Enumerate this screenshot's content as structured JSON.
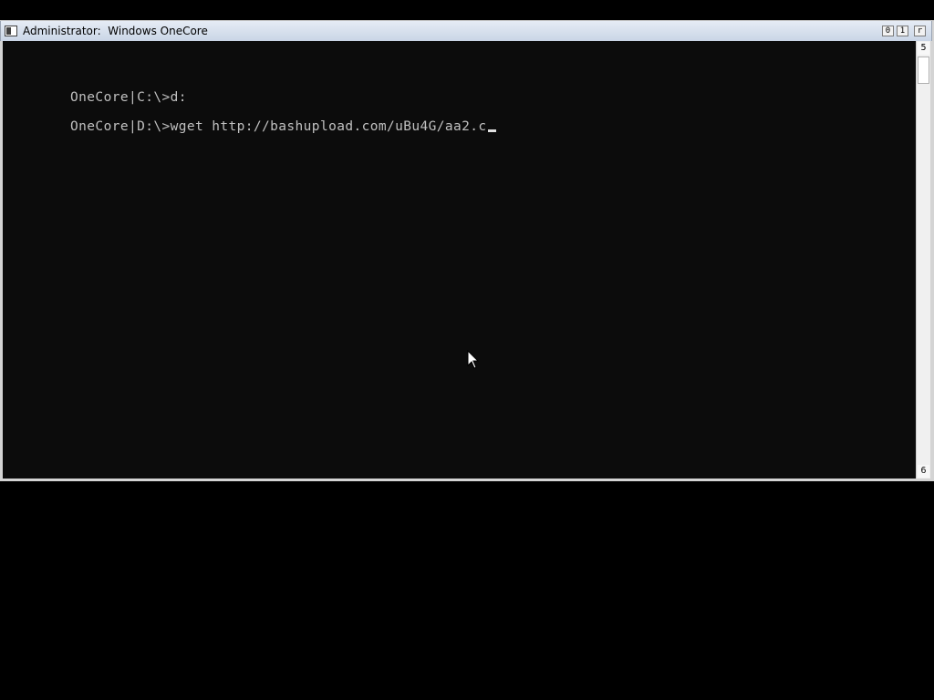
{
  "window": {
    "title": "Administrator:  Windows OneCore",
    "controls": {
      "minimize": "0",
      "maximize": "1",
      "close": "r"
    }
  },
  "console": {
    "lines": [
      "OneCore|C:\\>d:",
      "OneCore|D:\\>wget http://bashupload.com/uBu4G/aa2.c"
    ]
  },
  "scrollbar": {
    "up_glyph": "5",
    "down_glyph": "6"
  },
  "icons": {
    "window": "console-window-icon",
    "pointer": "mouse-pointer-icon"
  },
  "colors": {
    "console_background": "#0c0c0c",
    "console_text": "#c0c0c0",
    "desktop": "#000000"
  }
}
